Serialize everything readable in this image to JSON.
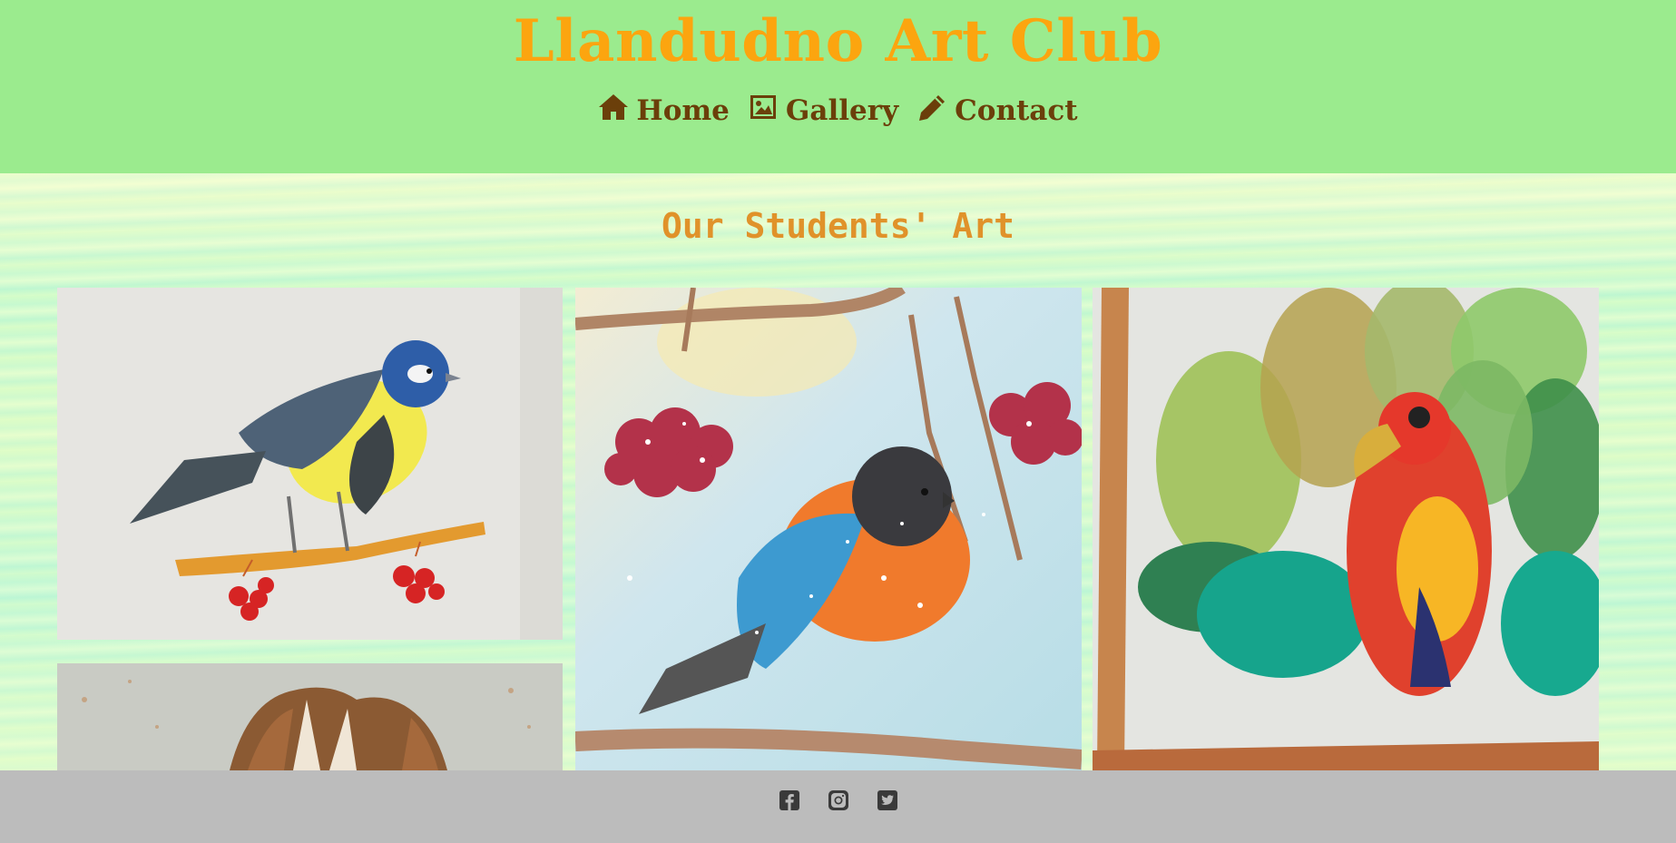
{
  "header": {
    "title": "Llandudno Art Club",
    "nav": [
      {
        "label": "Home",
        "icon": "home-icon"
      },
      {
        "label": "Gallery",
        "icon": "image-icon"
      },
      {
        "label": "Contact",
        "icon": "pencil-icon"
      }
    ]
  },
  "main": {
    "section_title": "Our Students' Art",
    "gallery": [
      {
        "subject": "yellow-blue-tit-on-berry-branch"
      },
      {
        "subject": "bullfinch-with-rowan-berries-in-snow"
      },
      {
        "subject": "red-parrot-among-leaves"
      },
      {
        "subject": "fox-fur-painting"
      }
    ]
  },
  "footer": {
    "social": [
      {
        "icon": "facebook-icon"
      },
      {
        "icon": "instagram-icon"
      },
      {
        "icon": "twitter-icon"
      }
    ]
  },
  "colors": {
    "header_bg": "#9beb8e",
    "title": "#fca50f",
    "nav_text": "#6b3f0a",
    "section_title": "#e0922a",
    "footer_bg": "#bcbcbc"
  }
}
